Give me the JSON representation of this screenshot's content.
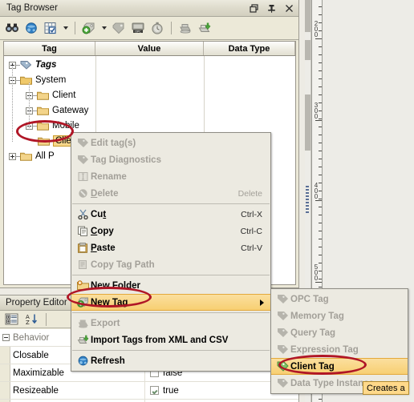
{
  "window": {
    "title": "Tag Browser",
    "buttons": [
      {
        "name": "restore",
        "label": "Restore"
      },
      {
        "name": "pin",
        "label": "Pin"
      },
      {
        "name": "close",
        "label": "Close"
      }
    ]
  },
  "toolbar": {
    "items": [
      {
        "name": "find-icon",
        "label": "Find"
      },
      {
        "name": "browse-icon",
        "label": "Browse"
      },
      {
        "name": "grid-check-icon",
        "label": "Select Tags"
      },
      {
        "name": "dropdown-arrow-1",
        "label": ""
      },
      {
        "name": "new-tag-icon",
        "label": "New Tag"
      },
      {
        "name": "dropdown-arrow-2",
        "label": ""
      },
      {
        "name": "tag-icon",
        "label": "Tag"
      },
      {
        "name": "opc-icon",
        "label": "OPC"
      },
      {
        "name": "stopwatch-icon",
        "label": "Scan Class"
      },
      {
        "name": "export-icon",
        "label": "Export"
      },
      {
        "name": "import-icon",
        "label": "Import"
      }
    ]
  },
  "tree": {
    "columns": [
      "Tag",
      "Value",
      "Data Type"
    ],
    "nodes": [
      {
        "label": "Tags",
        "indent": 0,
        "toggle": "plus",
        "style": "italic",
        "selected": false
      },
      {
        "label": "System",
        "indent": 0,
        "toggle": "minus",
        "style": "normal",
        "selected": false
      },
      {
        "label": "Client",
        "indent": 1,
        "toggle": "plus",
        "style": "normal",
        "selected": false
      },
      {
        "label": "Gateway",
        "indent": 1,
        "toggle": "plus",
        "style": "normal",
        "selected": false
      },
      {
        "label": "Mobile",
        "indent": 1,
        "toggle": "plus",
        "style": "normal",
        "selected": false
      },
      {
        "label": "Client",
        "indent": 1,
        "toggle": "none",
        "style": "normal",
        "selected": true
      },
      {
        "label": "All P",
        "indent": 0,
        "toggle": "plus",
        "style": "normal",
        "selected": false
      }
    ]
  },
  "context_menu": {
    "items": [
      {
        "label": "Edit tag(s)",
        "icon": "tag-icon",
        "accel": "",
        "disabled": true,
        "highlight": false,
        "submenu": false,
        "underline": ""
      },
      {
        "label": "Tag Diagnostics",
        "icon": "tag-diag-icon",
        "accel": "",
        "disabled": true,
        "highlight": false,
        "submenu": false,
        "underline": ""
      },
      {
        "label": "Rename",
        "icon": "rename-icon",
        "accel": "",
        "disabled": true,
        "highlight": false,
        "submenu": false,
        "underline": ""
      },
      {
        "label": "Delete",
        "icon": "delete-icon",
        "accel": "Delete",
        "disabled": true,
        "highlight": false,
        "submenu": false,
        "underline": "D"
      },
      {
        "separator": true
      },
      {
        "label": "Cut",
        "icon": "cut-icon",
        "accel": "Ctrl-X",
        "disabled": false,
        "highlight": false,
        "submenu": false,
        "underline": "t"
      },
      {
        "label": "Copy",
        "icon": "copy-icon",
        "accel": "Ctrl-C",
        "disabled": false,
        "highlight": false,
        "submenu": false,
        "underline": "C"
      },
      {
        "label": "Paste",
        "icon": "paste-icon",
        "accel": "Ctrl-V",
        "disabled": false,
        "highlight": false,
        "submenu": false,
        "underline": "P"
      },
      {
        "label": "Copy Tag Path",
        "icon": "copypath-icon",
        "accel": "",
        "disabled": true,
        "highlight": false,
        "submenu": false,
        "underline": ""
      },
      {
        "separator": true
      },
      {
        "label": "New Folder",
        "icon": "new-folder-icon",
        "accel": "",
        "disabled": false,
        "highlight": false,
        "submenu": false,
        "underline": ""
      },
      {
        "label": "New Tag",
        "icon": "new-tag-icon",
        "accel": "",
        "disabled": false,
        "highlight": true,
        "submenu": true,
        "underline": ""
      },
      {
        "separator": true
      },
      {
        "label": "Export",
        "icon": "export-icon",
        "accel": "",
        "disabled": true,
        "highlight": false,
        "submenu": false,
        "underline": ""
      },
      {
        "label": "Import Tags from XML and CSV",
        "icon": "import-icon",
        "accel": "",
        "disabled": false,
        "highlight": false,
        "submenu": false,
        "underline": ""
      },
      {
        "separator": true
      },
      {
        "label": "Refresh",
        "icon": "refresh-icon",
        "accel": "",
        "disabled": false,
        "highlight": false,
        "submenu": false,
        "underline": ""
      }
    ]
  },
  "submenu": {
    "items": [
      {
        "label": "OPC Tag",
        "icon": "tag-icon",
        "disabled": true,
        "highlight": false,
        "submenu": false
      },
      {
        "label": "Memory Tag",
        "icon": "tag-icon",
        "disabled": true,
        "highlight": false,
        "submenu": false
      },
      {
        "label": "Query Tag",
        "icon": "tag-icon",
        "disabled": true,
        "highlight": false,
        "submenu": false
      },
      {
        "label": "Expression Tag",
        "icon": "tag-icon",
        "disabled": true,
        "highlight": false,
        "submenu": false
      },
      {
        "label": "Client Tag",
        "icon": "green-tag-icon",
        "disabled": false,
        "highlight": true,
        "submenu": false
      },
      {
        "label": "Data Type Instance",
        "icon": "tag-icon",
        "disabled": true,
        "highlight": false,
        "submenu": true
      }
    ]
  },
  "tooltip": {
    "text": "Creates a"
  },
  "property_editor": {
    "title": "Property Editor",
    "toolbar": [
      {
        "name": "categorize-icon",
        "label": "Categorized"
      },
      {
        "name": "sort-az-icon",
        "label": "Alphabetic"
      }
    ],
    "rows": [
      {
        "name": "Behavior",
        "category": true,
        "value": "",
        "checkbox": null
      },
      {
        "name": "Closable",
        "category": false,
        "value": "",
        "checkbox": null
      },
      {
        "name": "Maximizable",
        "category": false,
        "value": "false",
        "checkbox": false
      },
      {
        "name": "Resizeable",
        "category": false,
        "value": "true",
        "checkbox": true
      }
    ]
  },
  "ruler": {
    "labels": [
      "200",
      "300",
      "400",
      "500"
    ]
  },
  "colors": {
    "highlight": "#f7cf72",
    "annotation": "#b01626",
    "window_bg": "#ece9d8",
    "menu_bg": "#eceae1"
  }
}
